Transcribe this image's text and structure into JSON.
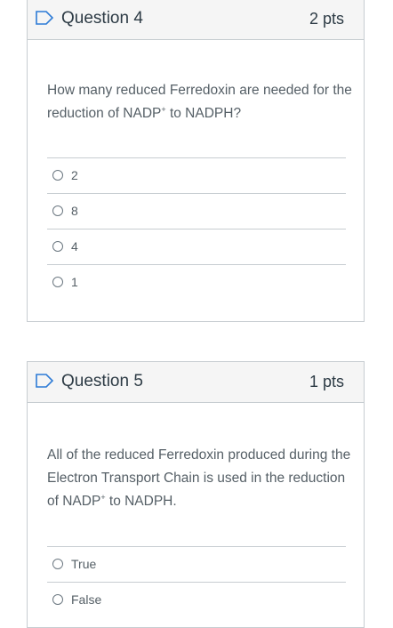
{
  "question4": {
    "title": "Question 4",
    "points": "2 pts",
    "text_before": "How many reduced Ferredoxin are needed for the reduction of NADP",
    "text_sup": "+",
    "text_after": " to NADPH?",
    "answers": [
      {
        "label": "2"
      },
      {
        "label": "8"
      },
      {
        "label": "4"
      },
      {
        "label": "1"
      }
    ]
  },
  "question5": {
    "title": "Question 5",
    "points": "1 pts",
    "text_before": "All of the reduced Ferredoxin produced during the Electron Transport Chain is used in the reduction of NADP",
    "text_sup": "+",
    "text_after": " to NADPH.",
    "answers": [
      {
        "label": "True"
      },
      {
        "label": "False"
      }
    ]
  },
  "icons": {
    "flag": "flag-outline-icon",
    "radio": "radio-unselected"
  },
  "colors": {
    "flag": "#2d7bd6",
    "border": "#c7cdd1",
    "header_bg": "#f5f5f5",
    "text": "#2d3b45"
  }
}
